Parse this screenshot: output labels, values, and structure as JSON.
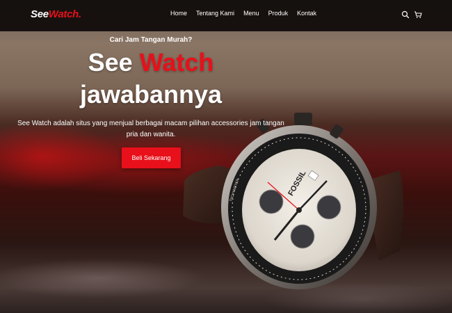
{
  "brand": {
    "name_main": "See",
    "name_accent": "Watch",
    "name_dot": "."
  },
  "nav": {
    "items": [
      {
        "label": "Home"
      },
      {
        "label": "Tentang Kami"
      },
      {
        "label": "Menu"
      },
      {
        "label": "Produk"
      },
      {
        "label": "Kontak"
      }
    ],
    "icons": [
      "search-icon",
      "cart-icon"
    ]
  },
  "hero": {
    "subtitle": "Cari Jam Tangan Murah?",
    "headline_white": "See",
    "headline_red": "Watch",
    "headline_line2": "jawabannya",
    "description": "See Watch adalah situs yang menjual berbagai macam pilihan accessories jam tangan pria dan wanita.",
    "cta_label": "Beli Sekarang",
    "watch_brand": "FOSSIL",
    "watch_tachymeter": "TACHYMETER"
  },
  "colors": {
    "accent": "#e8101a",
    "navbar": "#120e0c",
    "text": "#ffffff"
  }
}
